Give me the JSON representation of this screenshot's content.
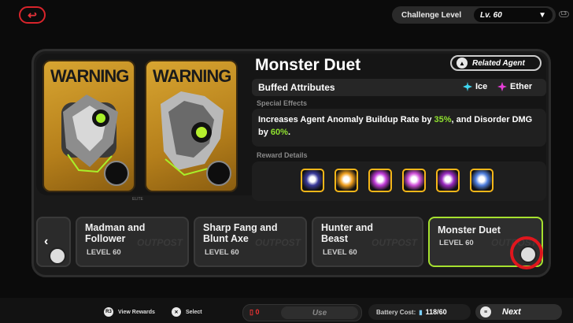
{
  "topbar": {
    "back_icon": "back-arrow-icon",
    "challenge_label": "Challenge Level",
    "challenge_value": "Lv. 60",
    "l3_hint": "L3"
  },
  "cards": {
    "warning_text": "WARNING",
    "elite_label": "ELITE"
  },
  "detail": {
    "title": "Monster Duet",
    "related_agent_label": "Related Agent",
    "buffed_label": "Buffed Attributes",
    "attributes": [
      {
        "label": "Ice",
        "color": "#3fd6f0"
      },
      {
        "label": "Ether",
        "color": "#e83ed9"
      }
    ],
    "special_effects_label": "Special Effects",
    "effects_text": {
      "p1": "Increases Agent Anomaly Buildup Rate by ",
      "v1": "35%",
      "p2": ", and Disorder DMG by ",
      "v2": "60%",
      "p3": "."
    },
    "reward_details_label": "Reward Details",
    "rewards": [
      {
        "icon": "reward-chip-icon",
        "color": "#3a3a9a"
      },
      {
        "icon": "reward-disc-icon",
        "color": "#f0a020"
      },
      {
        "icon": "reward-chip-icon",
        "color": "#c03ad8"
      },
      {
        "icon": "reward-disc-icon",
        "color": "#d050d8"
      },
      {
        "icon": "reward-battery-icon",
        "color": "#9a2ac0"
      },
      {
        "icon": "reward-crystal-icon",
        "color": "#5080e0"
      }
    ]
  },
  "stages": [
    {
      "name": "Madman and\nFollower",
      "level": "LEVEL 60",
      "watermark": "OUTPOST"
    },
    {
      "name": "Sharp Fang and\nBlunt Axe",
      "level": "LEVEL 60",
      "watermark": "OUTPOST"
    },
    {
      "name": "Hunter and\nBeast",
      "level": "LEVEL 60",
      "watermark": "OUTPOST"
    },
    {
      "name": "Monster Duet",
      "level": "LEVEL 60",
      "watermark": "OUTPOST"
    }
  ],
  "footer": {
    "view_rewards_key": "R3",
    "view_rewards": "View Rewards",
    "select_key": "✕",
    "select": "Select",
    "use_count": "0",
    "use_label": "Use",
    "battery_label": "Battery Cost:",
    "battery_value": "118/60",
    "next_key": "≡",
    "next_label": "Next"
  }
}
